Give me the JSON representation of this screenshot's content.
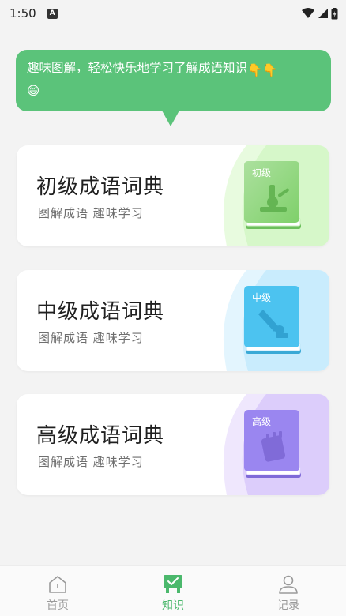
{
  "status_bar": {
    "time": "1:50",
    "notification_glyph": "A"
  },
  "bubble": {
    "text": "趣味图解，轻松快乐地学习了解成语知识",
    "emojis": [
      "👇",
      "👇",
      "😄"
    ]
  },
  "cards": [
    {
      "title": "初级成语词典",
      "subtitle": "图解成语 趣味学习",
      "book_label": "初级",
      "accent": "#7fd06a",
      "theme": "#d6f7c9"
    },
    {
      "title": "中级成语词典",
      "subtitle": "图解成语 趣味学习",
      "book_label": "中级",
      "accent": "#4cc3f0",
      "theme": "#c9ecfd"
    },
    {
      "title": "高级成语词典",
      "subtitle": "图解成语 趣味学习",
      "book_label": "高级",
      "accent": "#9a86f0",
      "theme": "#dccdfb"
    }
  ],
  "bottom_nav": {
    "items": [
      {
        "label": "首页",
        "icon": "home-icon",
        "active": false
      },
      {
        "label": "知识",
        "icon": "knowledge-icon",
        "active": true
      },
      {
        "label": "记录",
        "icon": "user-icon",
        "active": false
      }
    ],
    "active_color": "#4bb86c"
  }
}
